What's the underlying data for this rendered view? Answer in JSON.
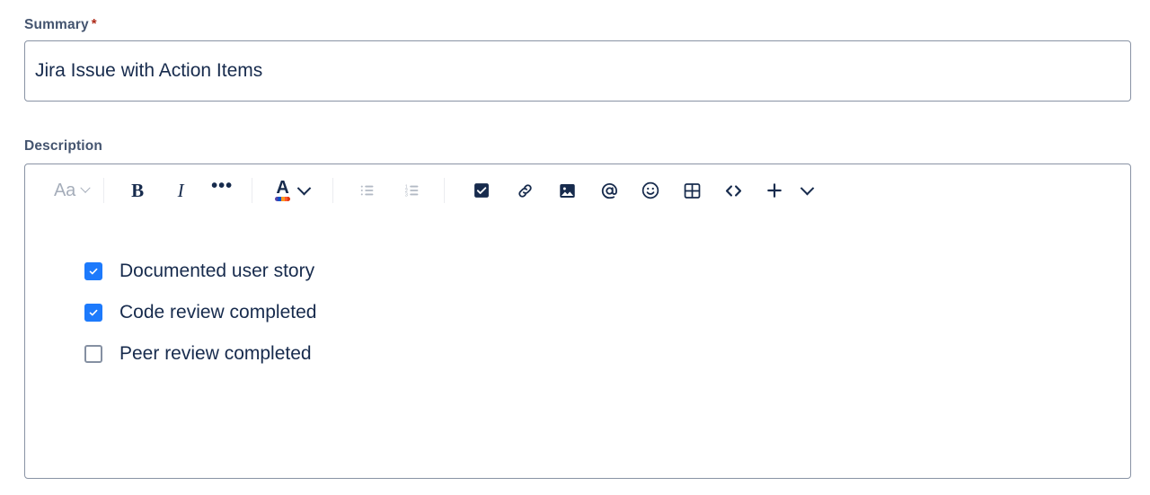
{
  "form": {
    "summary": {
      "label": "Summary",
      "required_marker": "*",
      "value": "Jira Issue with Action Items",
      "placeholder": ""
    },
    "description": {
      "label": "Description"
    }
  },
  "toolbar": {
    "groups": [
      {
        "name": "text-style-group",
        "items": [
          {
            "name": "text-style-dropdown",
            "label": "Aa",
            "icon": "chevron-down-icon",
            "state": "disabled"
          }
        ]
      },
      {
        "name": "text-format-group",
        "items": [
          {
            "name": "bold-button",
            "label": "B",
            "icon": "bold-icon",
            "state": "enabled"
          },
          {
            "name": "italic-button",
            "label": "I",
            "icon": "italic-icon",
            "state": "enabled"
          },
          {
            "name": "more-formatting-button",
            "label": "•••",
            "icon": "ellipsis-icon",
            "state": "enabled"
          }
        ]
      },
      {
        "name": "text-color-group",
        "items": [
          {
            "name": "text-color-button",
            "label": "A",
            "icon": "text-color-icon",
            "state": "enabled"
          }
        ]
      },
      {
        "name": "list-group",
        "items": [
          {
            "name": "bullet-list-button",
            "label": "",
            "icon": "bullet-list-icon",
            "state": "disabled"
          },
          {
            "name": "numbered-list-button",
            "label": "",
            "icon": "numbered-list-icon",
            "state": "disabled"
          }
        ]
      },
      {
        "name": "insert-group",
        "items": [
          {
            "name": "action-item-button",
            "label": "",
            "icon": "checkbox-icon",
            "state": "active"
          },
          {
            "name": "link-button",
            "label": "",
            "icon": "link-icon",
            "state": "enabled"
          },
          {
            "name": "image-button",
            "label": "",
            "icon": "image-icon",
            "state": "enabled"
          },
          {
            "name": "mention-button",
            "label": "",
            "icon": "mention-at-icon",
            "state": "enabled"
          },
          {
            "name": "emoji-button",
            "label": "",
            "icon": "emoji-smiley-icon",
            "state": "enabled"
          },
          {
            "name": "table-button",
            "label": "",
            "icon": "table-icon",
            "state": "enabled"
          },
          {
            "name": "code-button",
            "label": "",
            "icon": "code-angle-brackets-icon",
            "state": "enabled"
          },
          {
            "name": "insert-more-button",
            "label": "",
            "icon": "plus-icon",
            "state": "enabled"
          },
          {
            "name": "insert-more-dropdown",
            "label": "",
            "icon": "chevron-down-icon",
            "state": "enabled"
          }
        ]
      }
    ]
  },
  "editor_content": {
    "type": "action-item-list",
    "items": [
      {
        "text": "Documented user story",
        "checked": true
      },
      {
        "text": "Code review completed",
        "checked": true
      },
      {
        "text": "Peer review completed",
        "checked": false
      }
    ]
  },
  "colors": {
    "label_text": "#44546F",
    "required_asterisk": "#AE2A19",
    "body_text": "#172B4D",
    "border": "#8993A4",
    "separator": "#EBECF0",
    "disabled_icon": "#A5ADBA",
    "checkbox_checked": "#1D7AFC",
    "checkbox_unchecked_border": "#8590A2",
    "toolbar_icon": "#172B4D",
    "background": "#FFFFFF"
  }
}
